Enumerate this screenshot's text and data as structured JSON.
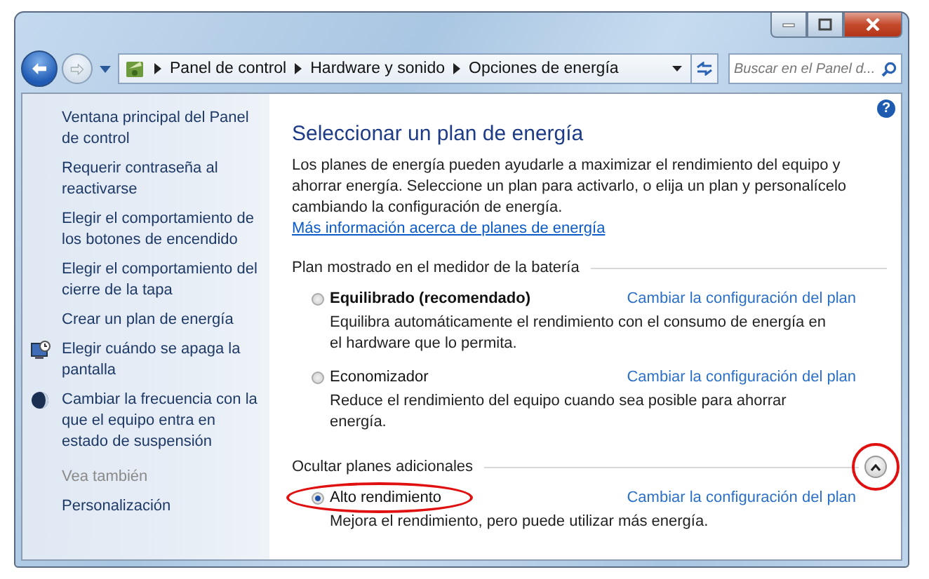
{
  "navigation": {
    "breadcrumbs": [
      "Panel de control",
      "Hardware y sonido",
      "Opciones de energía"
    ],
    "search": {
      "placeholder": "Buscar en el Panel d..."
    }
  },
  "sidebar": {
    "items": [
      {
        "text": "Ventana principal del Panel de control",
        "kind": "link"
      },
      {
        "text": "Requerir contraseña al reactivarse",
        "kind": "link"
      },
      {
        "text": "Elegir el comportamiento de los botones de encendido",
        "kind": "link"
      },
      {
        "text": "Elegir el comportamiento del cierre de la tapa",
        "kind": "link"
      },
      {
        "text": "Crear un plan de energía",
        "kind": "link"
      },
      {
        "text": "Elegir cuándo se apaga la pantalla",
        "kind": "monitor"
      },
      {
        "text": "Cambiar la frecuencia con la que el equipo entra en estado de suspensión",
        "kind": "moon"
      }
    ],
    "see_also": {
      "heading": "Vea también",
      "items": [
        "Personalización"
      ]
    }
  },
  "main": {
    "help": "?",
    "title": "Seleccionar un plan de energía",
    "intro": "Los planes de energía pueden ayudarle a maximizar el rendimiento del equipo y ahorrar energía. Seleccione un plan para activarlo, o elija un plan y personalícelo cambiando la configuración de energía.",
    "intro_link": "Más información acerca de planes de energía",
    "groups": [
      {
        "heading": "Plan mostrado en el medidor de la batería",
        "collapse_button": false,
        "plans": [
          {
            "name": "Equilibrado (recomendado)",
            "bold": true,
            "selected": false,
            "highlighted": false,
            "link": "Cambiar la configuración del plan",
            "description": "Equilibra automáticamente el rendimiento con el consumo de energía en el hardware que lo permita."
          },
          {
            "name": "Economizador",
            "bold": false,
            "selected": false,
            "highlighted": false,
            "link": "Cambiar la configuración del plan",
            "description": "Reduce el rendimiento del equipo cuando sea posible para ahorrar energía."
          }
        ]
      },
      {
        "heading": "Ocultar planes adicionales",
        "collapse_button": true,
        "highlighted": true,
        "plans": [
          {
            "name": "Alto rendimiento",
            "bold": false,
            "selected": true,
            "highlighted": true,
            "link": "Cambiar la configuración del plan",
            "description": "Mejora el rendimiento, pero puede utilizar más energía."
          }
        ]
      }
    ]
  }
}
